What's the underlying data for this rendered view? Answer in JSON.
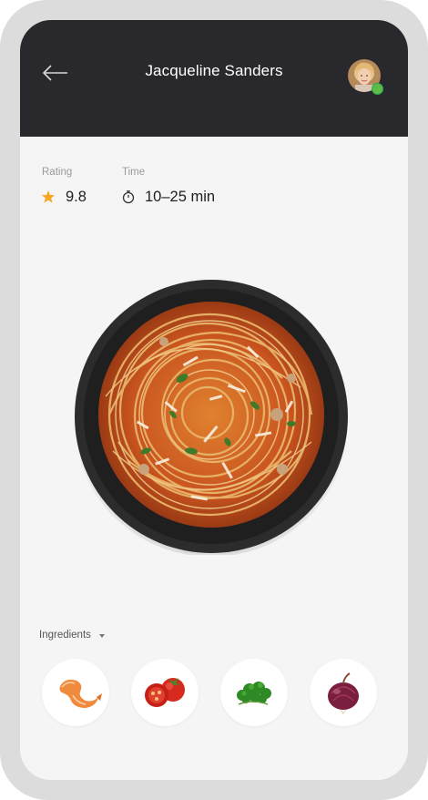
{
  "header": {
    "title": "Jacqueline Sanders",
    "back_icon": "arrow-left-icon",
    "avatar_status": "online"
  },
  "stats": {
    "rating": {
      "label": "Rating",
      "value": "9.8",
      "icon": "star-icon"
    },
    "time": {
      "label": "Time",
      "value": "10–25 min",
      "icon": "stopwatch-icon"
    }
  },
  "dish": {
    "image": "spaghetti-bowl"
  },
  "ingredients": {
    "label": "Ingredients",
    "items": [
      {
        "name": "shrimp",
        "icon": "shrimp-icon"
      },
      {
        "name": "tomatoes",
        "icon": "tomato-icon"
      },
      {
        "name": "parsley",
        "icon": "parsley-icon"
      },
      {
        "name": "onion",
        "icon": "onion-icon"
      }
    ]
  },
  "colors": {
    "header_bg": "#29282d",
    "accent_star": "#f5a623",
    "online": "#5fbb46",
    "screen_bg": "#f5f5f5"
  }
}
